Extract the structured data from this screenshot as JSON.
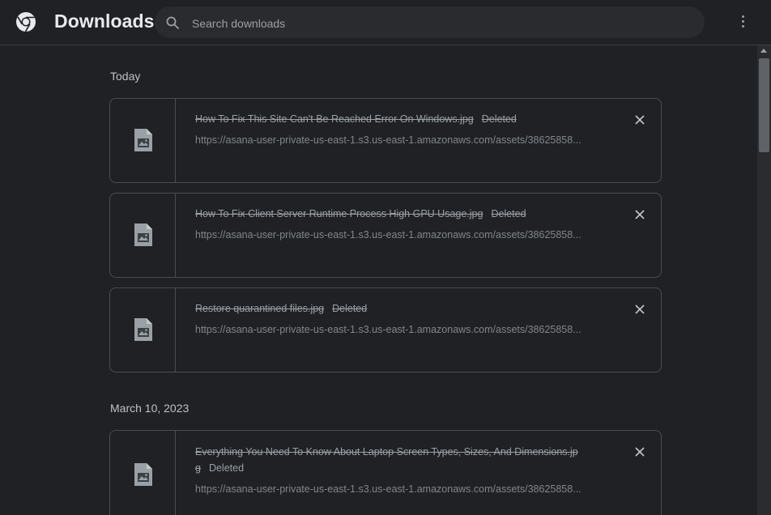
{
  "header": {
    "title": "Downloads",
    "logo_icon": "chrome-logo-icon",
    "menu_icon": "more-vert-icon"
  },
  "search": {
    "placeholder": "Search downloads",
    "value": "",
    "icon": "search-icon"
  },
  "groups": [
    {
      "date": "Today",
      "items": [
        {
          "name": "How To Fix This Site Can't Be Reached Error On Windows.jpg",
          "status": "Deleted",
          "url": "https://asana-user-private-us-east-1.s3.us-east-1.amazonaws.com/assets/38625858...",
          "icon": "image-file-icon"
        },
        {
          "name": "How To Fix Client Server Runtime Process High GPU Usage.jpg",
          "status": "Deleted",
          "url": "https://asana-user-private-us-east-1.s3.us-east-1.amazonaws.com/assets/38625858...",
          "icon": "image-file-icon"
        },
        {
          "name": "Restore quarantined files.jpg",
          "status": "Deleted",
          "url": "https://asana-user-private-us-east-1.s3.us-east-1.amazonaws.com/assets/38625858...",
          "icon": "image-file-icon"
        }
      ]
    },
    {
      "date": "March 10, 2023",
      "items": [
        {
          "name_line1": "Everything You Need To Know About Laptop Screen Types, Sizes, And Dimensions.jp",
          "name_line2": "g",
          "status": "Deleted",
          "url": "https://asana-user-private-us-east-1.s3.us-east-1.amazonaws.com/assets/38625858...",
          "icon": "image-file-icon"
        }
      ]
    }
  ],
  "colors": {
    "background": "#202124",
    "card_border": "#4a4c50",
    "text_primary": "#e8eaed",
    "text_secondary": "#9aa0a6"
  }
}
